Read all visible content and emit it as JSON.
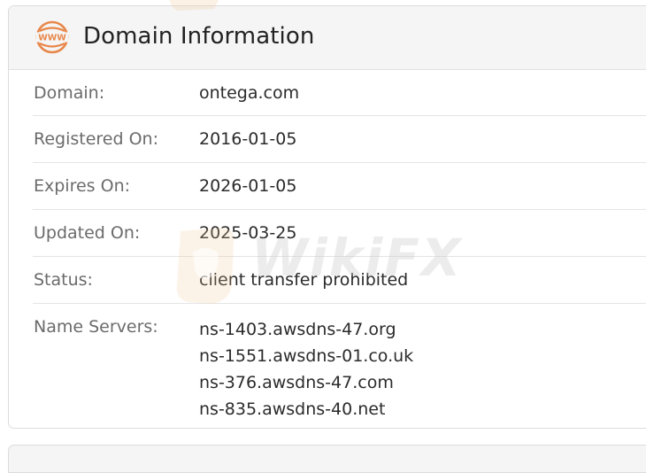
{
  "header": {
    "title": "Domain Information",
    "icon": "www-globe-icon",
    "icon_text": "WWW",
    "accent_color": "#e8874a"
  },
  "rows": [
    {
      "label": "Domain:",
      "value": "ontega.com"
    },
    {
      "label": "Registered On:",
      "value": "2016-01-05"
    },
    {
      "label": "Expires On:",
      "value": "2026-01-05"
    },
    {
      "label": "Updated On:",
      "value": "2025-03-25"
    },
    {
      "label": "Status:",
      "value": "client transfer prohibited"
    }
  ],
  "name_servers": {
    "label": "Name Servers:",
    "values": [
      "ns-1403.awsdns-47.org",
      "ns-1551.awsdns-01.co.uk",
      "ns-376.awsdns-47.com",
      "ns-835.awsdns-40.net"
    ]
  },
  "watermark": {
    "text": "WikiFX"
  }
}
